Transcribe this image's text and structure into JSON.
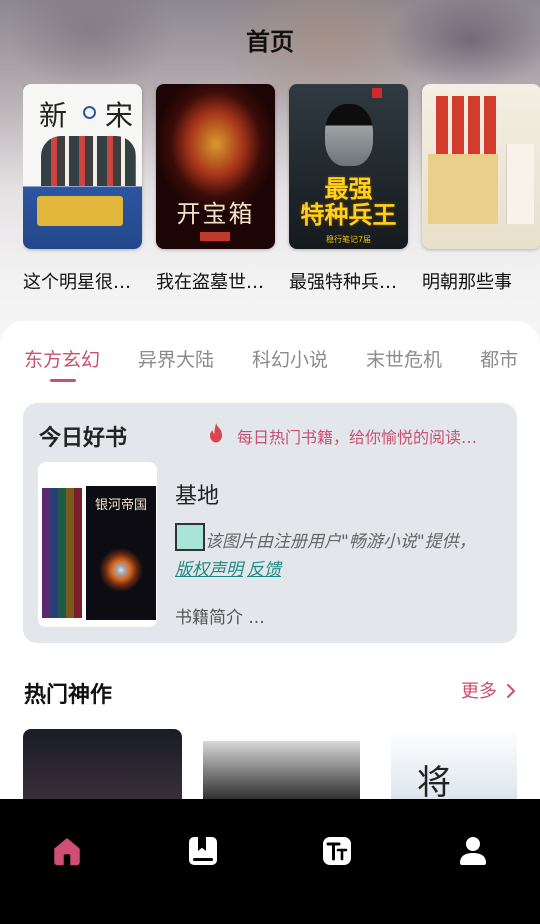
{
  "header": {
    "title": "首页"
  },
  "hero_books": [
    {
      "title": "这个明星很…",
      "cover": {
        "line1": "新",
        "line2": "宋"
      }
    },
    {
      "title": "我在盗墓世…",
      "cover": {
        "line1": "开宝箱"
      }
    },
    {
      "title": "最强特种兵…",
      "cover": {
        "line1": "最强",
        "line2": "特种兵王",
        "line3": "稳行笔记7届"
      }
    },
    {
      "title": "明朝那些事"
    }
  ],
  "category_tabs": [
    "东方玄幻",
    "异界大陆",
    "科幻小说",
    "末世危机",
    "都市"
  ],
  "today": {
    "title": "今日好书",
    "slogan": "每日热门书籍，给你愉悦的阅读…",
    "cover_title": "银河帝国",
    "book_name": "基地",
    "notice": "该图片由注册用户\"畅游小说\"提供，",
    "link_copyright": "版权声明",
    "link_feedback": "反馈",
    "intro": "书籍简介 ..."
  },
  "hot": {
    "title": "热门神作",
    "more": "更多",
    "books": [
      {
        "cover_text": ""
      },
      {
        "cover_text": ""
      },
      {
        "cover_text": "将"
      }
    ]
  },
  "bottom_nav": {
    "items": [
      {
        "name": "home",
        "icon": "home-icon",
        "active": true
      },
      {
        "name": "bookshelf",
        "icon": "bookmark-book-icon",
        "active": false
      },
      {
        "name": "font",
        "icon": "text-size-icon",
        "active": false
      },
      {
        "name": "user",
        "icon": "user-icon",
        "active": false
      }
    ]
  },
  "colors": {
    "accent": "#c9506e",
    "card_bg": "#e3e7ec",
    "link": "#1f8a83",
    "nav_bg": "#000000",
    "nav_active": "#cf4e73",
    "nav_inactive": "#ffffff"
  }
}
